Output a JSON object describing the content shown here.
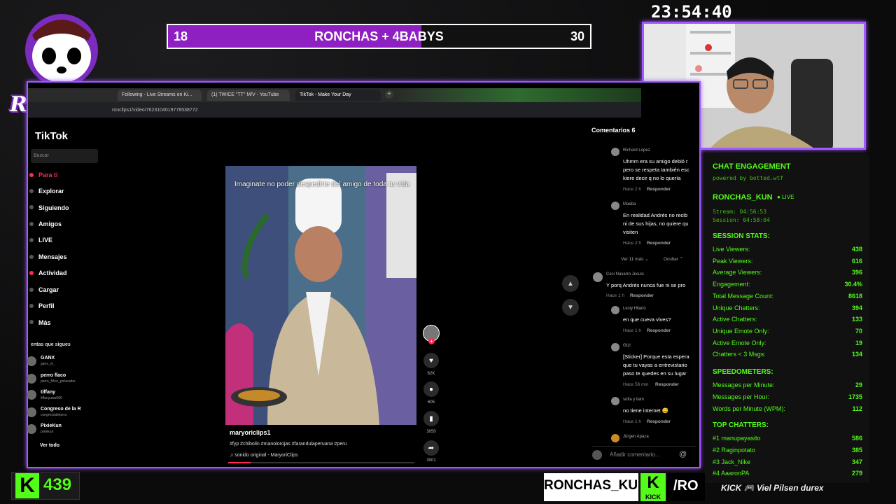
{
  "logo": {
    "text": "RONCHAS"
  },
  "goal": {
    "left_value": 18,
    "title": "RONCHAS + 4BABYS",
    "right_value": 30,
    "progress": 0.6,
    "fill_color": "#8e1fc0"
  },
  "clock": "23:54:40",
  "browser": {
    "tabs": [
      {
        "label": "Following - Live Streams on Ki..."
      },
      {
        "label": "(1) TWICE \"TT\" M/V - YouTube"
      },
      {
        "label": "TikTok - Make Your Day"
      }
    ],
    "url": "ronclips1/video/7623104019778538772"
  },
  "tiktok": {
    "brand": "TikTok",
    "search_placeholder": "Buscar",
    "nav": [
      "Para ti",
      "Explorar",
      "Siguiendo",
      "Amigos",
      "LIVE",
      "Mensajes",
      "Actividad",
      "Cargar",
      "Perfil",
      "Más"
    ],
    "following_title": "entas que sigues",
    "accounts": [
      {
        "name": "GANX",
        "handle": "ganx_yt_"
      },
      {
        "name": "perro flaco",
        "handle": "perro_fl4co_polveador"
      },
      {
        "name": "tiffany",
        "handle": "tiffanyuwu666"
      },
      {
        "name": "Congreso de la R",
        "handle": "congresodelperu"
      },
      {
        "name": "PixieKun",
        "handle": "pixiekun"
      }
    ],
    "see_all": "Ver todo",
    "video": {
      "caption": "Imaginate no poder despedirte del amigo de toda tu vida",
      "author": "maryoriclips1",
      "tags": "#fyp #chibolin #manolorojas #farandulaperuana #peru",
      "sound": "♫ sonido original - MaryoriClips",
      "progress": 0.12,
      "likes": "62K",
      "comments": "605",
      "saves": "3050",
      "shares": "3001"
    },
    "comments_title": "Comentarios 6",
    "comments": [
      {
        "user": "Richard Lopez",
        "lines": [
          "Uhmm era su amigo debió r",
          "pero se respeta también esc",
          "kiere decir q no lo quería"
        ],
        "time": "Hace 2 h",
        "reply": "Responder"
      },
      {
        "user": "Maeba",
        "lines": [
          "En realidad Andrés no recib",
          "ni de sus hijas, no quiere qu",
          "visiten"
        ],
        "time": "Hace 2 h",
        "reply": "Responder"
      },
      {
        "user": "Ceci Navarro Jesusi",
        "lines": [
          "Y porq Andrés nunca fue ni se pro"
        ],
        "time": "Hace 1 h",
        "reply": "Responder"
      },
      {
        "user": "Lesly Hilario",
        "lines": [
          "en que cueva vives?"
        ],
        "time": "Hace 1 h",
        "reply": "Responder"
      },
      {
        "user": "Gtzl",
        "lines": [
          "[Sticker] Porque esta espera",
          "que tu vayas a entrevistario",
          "paso te quedes en su lugar"
        ],
        "time": "Hace 56 min",
        "reply": "Responder"
      },
      {
        "user": "sofia y liam",
        "lines": [
          "no tiene internet 😅"
        ],
        "time": "Hace 1 h",
        "reply": "Responder"
      },
      {
        "user": "Jürgen Apaza",
        "lines": [],
        "time": "",
        "reply": ""
      }
    ],
    "view_more": "Ver 11 más ⌄",
    "hide": "Ocultar ⌃",
    "add_comment_placeholder": "Añadir comentario..."
  },
  "stats": {
    "title": "CHAT ENGAGEMENT",
    "powered": "powered by botted.wtf",
    "channel": "RONCHAS_KUN",
    "live": "● LIVE",
    "stream": "Stream: 04:56:53",
    "session": "Session: 04:58:04",
    "session_title": "SESSION STATS:",
    "session_rows": [
      {
        "label": "Live Viewers:",
        "value": "438"
      },
      {
        "label": "Peak Viewers:",
        "value": "616"
      },
      {
        "label": "Average Viewers:",
        "value": "396"
      },
      {
        "label": "Engagement:",
        "value": "30.4%"
      },
      {
        "label": "Total Message Count:",
        "value": "8618"
      },
      {
        "label": "Unique Chatters:",
        "value": "394"
      },
      {
        "label": "Active Chatters:",
        "value": "133"
      },
      {
        "label": "Unique Emote Only:",
        "value": "70"
      },
      {
        "label": "Active Emote Only:",
        "value": "19"
      },
      {
        "label": "Chatters < 3 Msgs:",
        "value": "134"
      }
    ],
    "speed_title": "SPEEDOMETERS:",
    "speed_rows": [
      {
        "label": "Messages per Minute:",
        "value": "29"
      },
      {
        "label": "Messages per Hour:",
        "value": "1735"
      },
      {
        "label": "Words per Minute (WPM):",
        "value": "112"
      }
    ],
    "top_title": "TOP CHATTERS:",
    "top_rows": [
      {
        "label": "#1 manupayasito",
        "value": "586"
      },
      {
        "label": "#2 Raginpotato",
        "value": "385"
      },
      {
        "label": "#3 Jack_Nike",
        "value": "347"
      },
      {
        "label": "#4 AaaronPA",
        "value": "279"
      }
    ]
  },
  "bottom": {
    "viewer_count": "439",
    "kick_letter": "K",
    "name": "RONCHAS_KUN",
    "kick_word": "KICK",
    "slash_text": "/RO",
    "sponsors": "KICK 🎮 Viel Pilsen durex"
  },
  "colors": {
    "accent": "#a259ff",
    "kick_green": "#53fc18",
    "tiktok_red": "#fe2c55"
  }
}
